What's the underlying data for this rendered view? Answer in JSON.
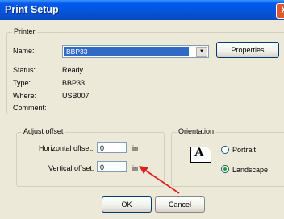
{
  "window": {
    "title": "Print Setup",
    "close_glyph": "X"
  },
  "printer": {
    "group_label": "Printer",
    "name_label": "Name:",
    "name_value": "BBP33",
    "properties_label": "Properties",
    "status_label": "Status:",
    "status_value": "Ready",
    "type_label": "Type:",
    "type_value": "BBP33",
    "where_label": "Where:",
    "where_value": "USB007",
    "comment_label": "Comment:",
    "comment_value": ""
  },
  "offset": {
    "group_label": "Adjust offset",
    "horizontal_label": "Horizontal offset:",
    "horizontal_value": "0",
    "horizontal_unit": "in",
    "vertical_label": "Vertical offset:",
    "vertical_value": "0",
    "vertical_unit": "in"
  },
  "orientation": {
    "group_label": "Orientation",
    "icon_letter": "A",
    "portrait_label": "Portrait",
    "landscape_label": "Landscape",
    "selected": "Landscape"
  },
  "buttons": {
    "ok_label": "OK",
    "cancel_label": "Cancel"
  },
  "annotation": {
    "arrow_color": "#E02020"
  }
}
